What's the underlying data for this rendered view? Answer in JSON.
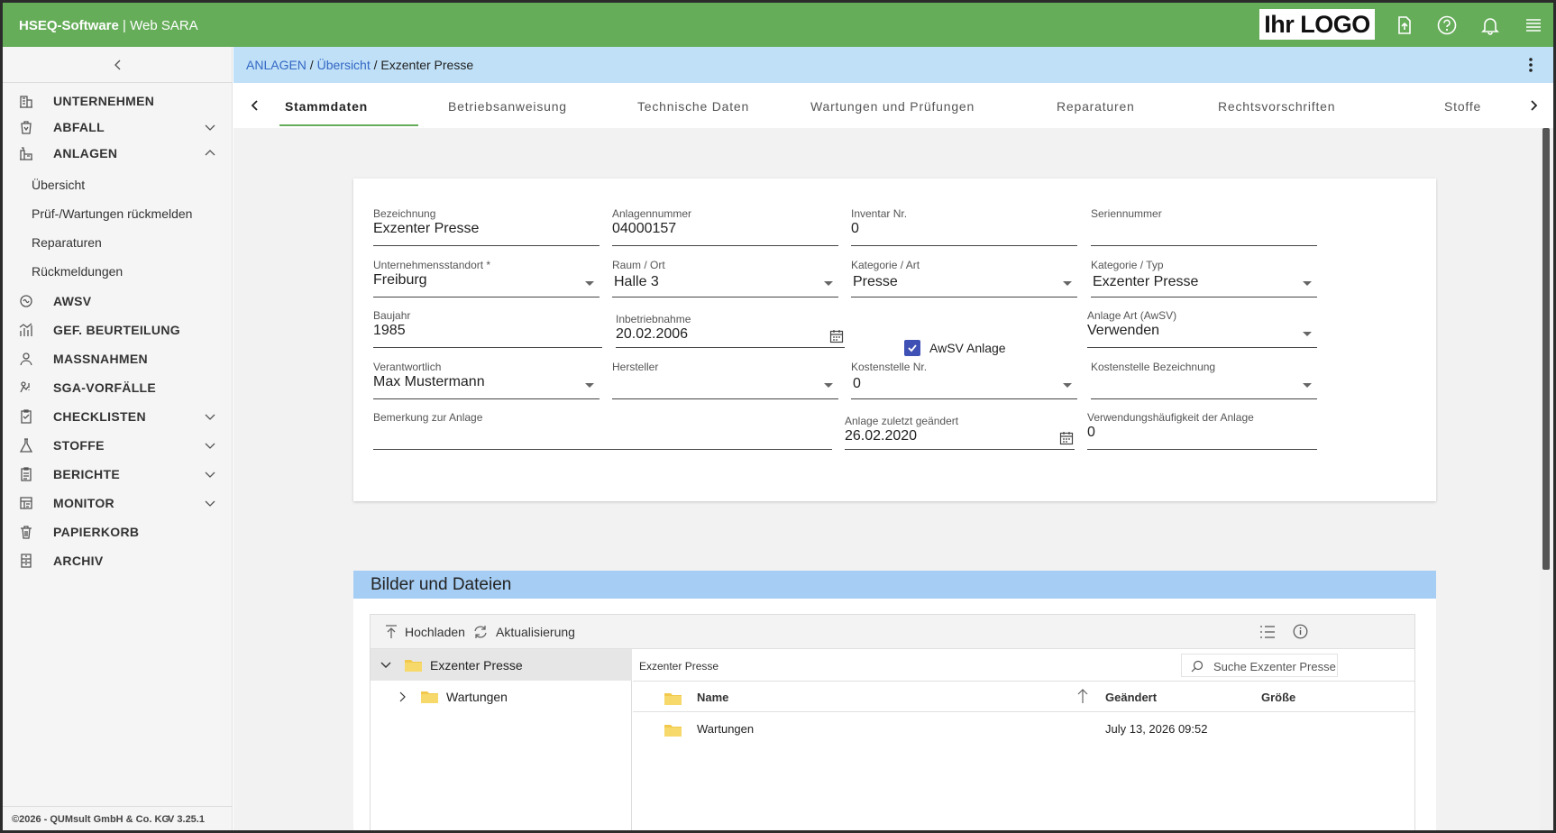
{
  "header": {
    "brand_bold": "HSEQ-Software",
    "brand_sep": " | ",
    "brand_rest": "Web SARA",
    "logo_text": "Ihr LOGO",
    "icons": [
      "upload-icon",
      "help-icon",
      "bell-icon",
      "menu-icon"
    ],
    "accent_color": "#66ad5a"
  },
  "sidebar": {
    "items": [
      {
        "label": "UNTERNEHMEN",
        "icon": "building-icon"
      },
      {
        "label": "ABFALL",
        "icon": "waste-icon",
        "expandable": true
      },
      {
        "label": "ANLAGEN",
        "icon": "machine-icon",
        "expanded": true
      },
      {
        "label": "AWSV",
        "icon": "water-icon"
      },
      {
        "label": "GEF. BEURTEILUNG",
        "icon": "chart-icon"
      },
      {
        "label": "MASSNAHMEN",
        "icon": "people-icon"
      },
      {
        "label": "SGA-VORFÄLLE",
        "icon": "incident-icon"
      },
      {
        "label": "CHECKLISTEN",
        "icon": "checklist-icon",
        "expandable": true
      },
      {
        "label": "STOFFE",
        "icon": "flask-icon",
        "expandable": true
      },
      {
        "label": "BERICHTE",
        "icon": "report-icon",
        "expandable": true
      },
      {
        "label": "MONITOR",
        "icon": "monitor-icon",
        "expandable": true
      },
      {
        "label": "PAPIERKORB",
        "icon": "trash-icon"
      },
      {
        "label": "ARCHIV",
        "icon": "archive-icon"
      }
    ],
    "anlagen_sub": [
      "Übersicht",
      "Prüf-/Wartungen rückmelden",
      "Reparaturen",
      "Rückmeldungen"
    ],
    "footer_left": "©2026 - QUMsult GmbH & Co. KG",
    "footer_right": "V 3.25.1"
  },
  "breadcrumb": {
    "part1": "ANLAGEN",
    "sep": " / ",
    "part2": "Übersicht",
    "part3": "Exzenter Presse"
  },
  "tabs": [
    "Stammdaten",
    "Betriebsanweisung",
    "Technische Daten",
    "Wartungen und Prüfungen",
    "Reparaturen",
    "Rechtsvorschriften",
    "Stoffe"
  ],
  "form": {
    "bezeichnung": {
      "label": "Bezeichnung",
      "value": "Exzenter Presse"
    },
    "anlagennummer": {
      "label": "Anlagennummer",
      "value": "04000157"
    },
    "inventar": {
      "label": "Inventar Nr.",
      "value": "0"
    },
    "seriennummer": {
      "label": "Seriennummer",
      "value": ""
    },
    "standort": {
      "label": "Unternehmensstandort *",
      "value": "Freiburg"
    },
    "raum": {
      "label": "Raum / Ort",
      "value": "Halle 3"
    },
    "kat_art": {
      "label": "Kategorie / Art",
      "value": "Presse"
    },
    "kat_typ": {
      "label": "Kategorie / Typ",
      "value": "Exzenter Presse"
    },
    "baujahr": {
      "label": "Baujahr",
      "value": "1985"
    },
    "inbetrieb": {
      "label": "Inbetriebnahme",
      "value": "20.02.2006"
    },
    "awsv": {
      "label": "AwSV Anlage",
      "checked": true
    },
    "anlage_art": {
      "label": "Anlage Art (AwSV)",
      "value": "Verwenden"
    },
    "verantwortlich": {
      "label": "Verantwortlich",
      "value": "Max Mustermann"
    },
    "hersteller": {
      "label": "Hersteller",
      "value": ""
    },
    "kst_nr": {
      "label": "Kostenstelle Nr.",
      "value": "0"
    },
    "kst_bez": {
      "label": "Kostenstelle Bezeichnung",
      "value": ""
    },
    "bemerkung": {
      "label": "Bemerkung zur Anlage",
      "value": ""
    },
    "geaendert": {
      "label": "Anlage zuletzt geändert",
      "value": "26.02.2020"
    },
    "haeufigkeit": {
      "label": "Verwendungshäufigkeit der Anlage",
      "value": "0"
    }
  },
  "files": {
    "title": "Bilder und Dateien",
    "upload_label": "Hochladen",
    "refresh_label": "Aktualisierung",
    "tree_root": "Exzenter Presse",
    "tree_child": "Wartungen",
    "path": "Exzenter Presse",
    "search_placeholder": "Suche Exzenter Presse",
    "columns": {
      "name": "Name",
      "changed": "Geändert",
      "size": "Größe"
    },
    "rows": [
      {
        "name": "Wartungen",
        "changed": "July 13, 2026 09:52",
        "size": ""
      }
    ],
    "header_color": "#a6cdf3"
  }
}
